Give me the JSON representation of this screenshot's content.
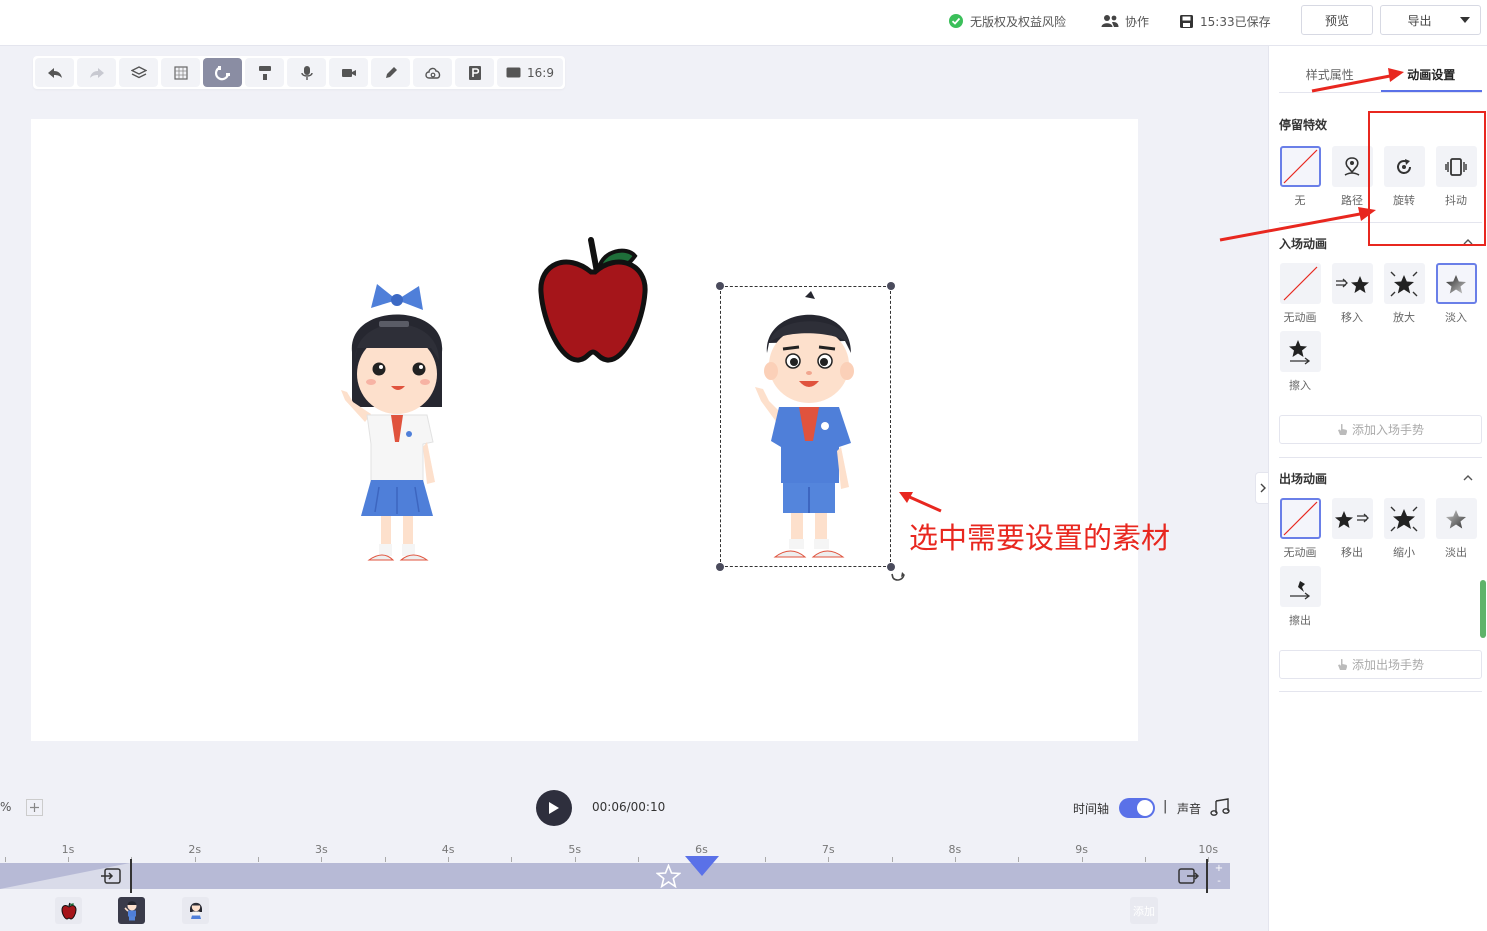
{
  "topbar": {
    "copyright_status": "无版权及权益风险",
    "collab": "协作",
    "saved": "15:33已保存",
    "preview": "预览",
    "export": "导出"
  },
  "toolbar": {
    "ratio": "16:9"
  },
  "canvas": {
    "annotation": "选中需要设置的素材"
  },
  "panel": {
    "tabs": [
      "样式属性",
      "动画设置"
    ],
    "stay_title": "停留特效",
    "stay_items": [
      "无",
      "路径",
      "旋转",
      "抖动"
    ],
    "enter_title": "入场动画",
    "enter_items": [
      "无动画",
      "移入",
      "放大",
      "淡入",
      "擦入"
    ],
    "enter_gesture": "添加入场手势",
    "exit_title": "出场动画",
    "exit_items": [
      "无动画",
      "移出",
      "缩小",
      "淡出",
      "擦出"
    ],
    "exit_gesture": "添加出场手势"
  },
  "player": {
    "time": "00:06/00:10",
    "zoom": "%",
    "timeline_label": "时间轴",
    "timeline_on": true,
    "separator": "|",
    "sound_label": "声音"
  },
  "timeline": {
    "ticks": [
      "1s",
      "2s",
      "3s",
      "4s",
      "5s",
      "6s",
      "7s",
      "8s",
      "9s",
      "10s"
    ],
    "add_label": "添加",
    "playhead_seconds": 6
  },
  "colors": {
    "accent": "#5a71e8",
    "annotation_red": "#e8271f",
    "track": "#b7bad6"
  }
}
